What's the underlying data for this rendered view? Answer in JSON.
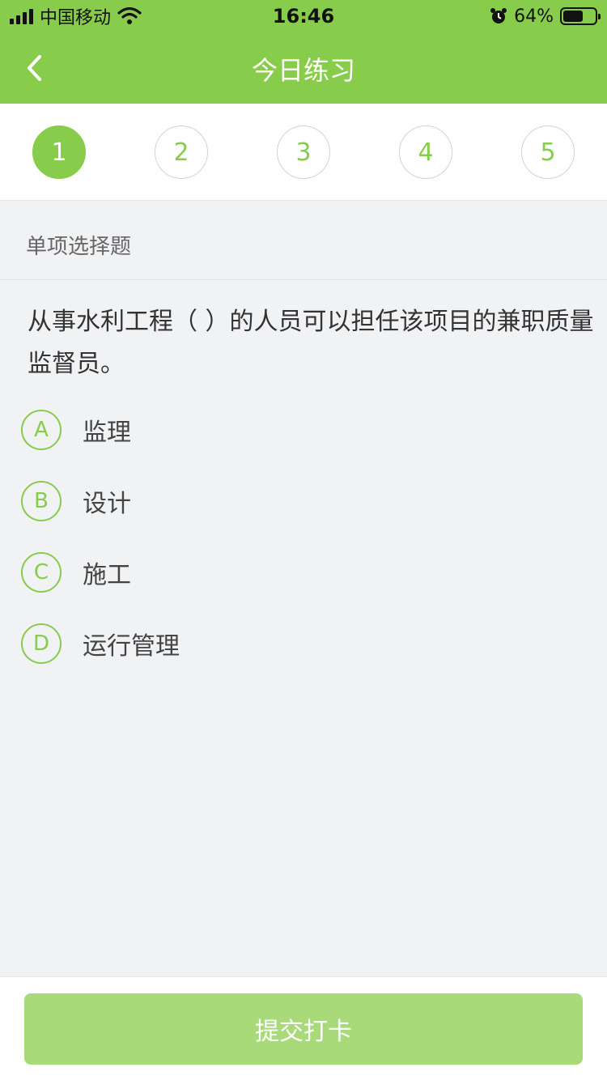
{
  "status_bar": {
    "carrier": "中国移动",
    "time": "16:46",
    "battery_text": "64%",
    "battery_level": 0.64
  },
  "nav": {
    "title": "今日练习",
    "back_icon": "chevron-left-icon"
  },
  "steps": [
    {
      "label": "1",
      "active": true
    },
    {
      "label": "2",
      "active": false
    },
    {
      "label": "3",
      "active": false
    },
    {
      "label": "4",
      "active": false
    },
    {
      "label": "5",
      "active": false
    }
  ],
  "question": {
    "type_label": "单项选择题",
    "text": "从事水利工程（  ）的人员可以担任该项目的兼职质量监督员。",
    "options": [
      {
        "letter": "A",
        "text": "监理"
      },
      {
        "letter": "B",
        "text": "设计"
      },
      {
        "letter": "C",
        "text": "施工"
      },
      {
        "letter": "D",
        "text": "运行管理"
      }
    ]
  },
  "footer": {
    "submit_label": "提交打卡"
  },
  "colors": {
    "primary": "#87cc4a",
    "button_disabled": "#a9da7a",
    "background": "#f1f2f4"
  }
}
